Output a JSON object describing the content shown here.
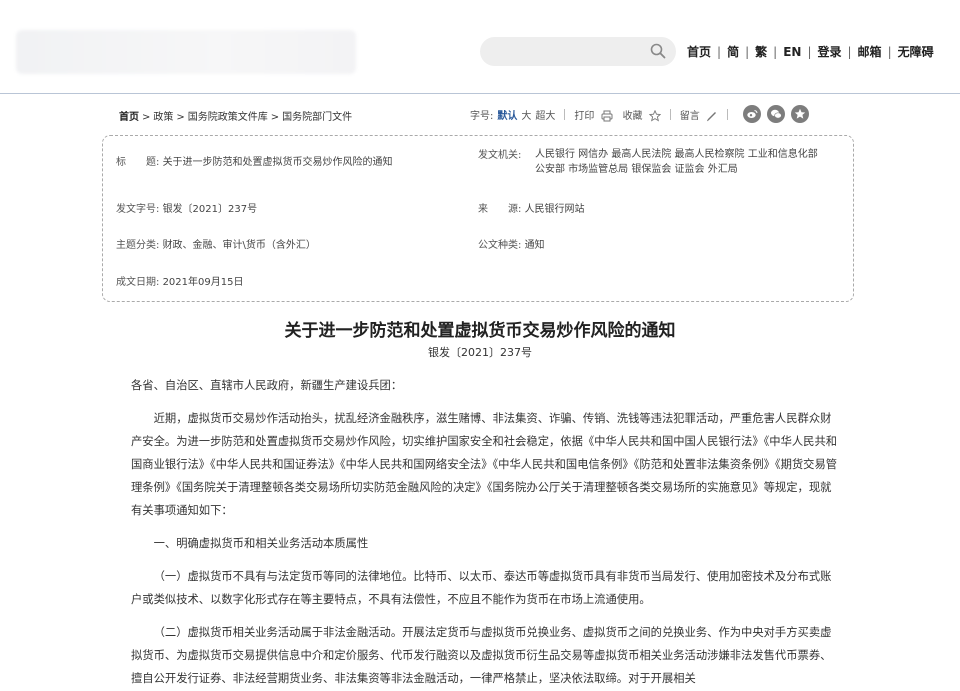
{
  "header": {
    "search": {
      "placeholder": ""
    },
    "nav": [
      "首页",
      "简",
      "繁",
      "EN",
      "登录",
      "邮箱",
      "无障碍"
    ]
  },
  "breadcrumb": {
    "items": [
      "首页",
      "政策",
      "国务院政策文件库",
      "国务院部门文件"
    ],
    "sep": ">"
  },
  "toolbar": {
    "font_label": "字号:",
    "font_default": "默认",
    "font_large": "大",
    "font_xlarge": "超大",
    "print": "打印",
    "favorite": "收藏",
    "comment": "留言"
  },
  "meta": {
    "title_label": "标　　题:",
    "title_value": "关于进一步防范和处置虚拟货币交易炒作风险的通知",
    "issuer_label": "发文机关:",
    "issuer_line1": "人民银行 网信办 最高人民法院 最高人民检察院 工业和信息化部",
    "issuer_line2": "公安部 市场监管总局 银保监会 证监会 外汇局",
    "docno_label": "发文字号:",
    "docno_value": "银发〔2021〕237号",
    "source_label": "来　　源:",
    "source_value": "人民银行网站",
    "topic_label": "主题分类:",
    "topic_value": "财政、金融、审计\\货币（含外汇）",
    "type_label": "公文种类:",
    "type_value": "通知",
    "date_label": "成文日期:",
    "date_value": "2021年09月15日"
  },
  "article": {
    "title": "关于进一步防范和处置虚拟货币交易炒作风险的通知",
    "docno": "银发〔2021〕237号",
    "salutation": "各省、自治区、直辖市人民政府，新疆生产建设兵团：",
    "para1": "近期，虚拟货币交易炒作活动抬头，扰乱经济金融秩序，滋生赌博、非法集资、诈骗、传销、洗钱等违法犯罪活动，严重危害人民群众财产安全。为进一步防范和处置虚拟货币交易炒作风险，切实维护国家安全和社会稳定，依据《中华人民共和国中国人民银行法》《中华人民共和国商业银行法》《中华人民共和国证券法》《中华人民共和国网络安全法》《中华人民共和国电信条例》《防范和处置非法集资条例》《期货交易管理条例》《国务院关于清理整顿各类交易场所切实防范金融风险的决定》《国务院办公厅关于清理整顿各类交易场所的实施意见》等规定，现就有关事项通知如下：",
    "heading1": "一、明确虚拟货币和相关业务活动本质属性",
    "para2": "（一）虚拟货币不具有与法定货币等同的法律地位。比特币、以太币、泰达币等虚拟货币具有非货币当局发行、使用加密技术及分布式账户或类似技术、以数字化形式存在等主要特点，不具有法偿性，不应且不能作为货币在市场上流通使用。",
    "para3": "（二）虚拟货币相关业务活动属于非法金融活动。开展法定货币与虚拟货币兑换业务、虚拟货币之间的兑换业务、作为中央对手方买卖虚拟货币、为虚拟货币交易提供信息中介和定价服务、代币发行融资以及虚拟货币衍生品交易等虚拟货币相关业务活动涉嫌非法发售代币票券、擅自公开发行证券、非法经营期货业务、非法集资等非法金融活动，一律严格禁止，坚决依法取缔。对于开展相关"
  }
}
